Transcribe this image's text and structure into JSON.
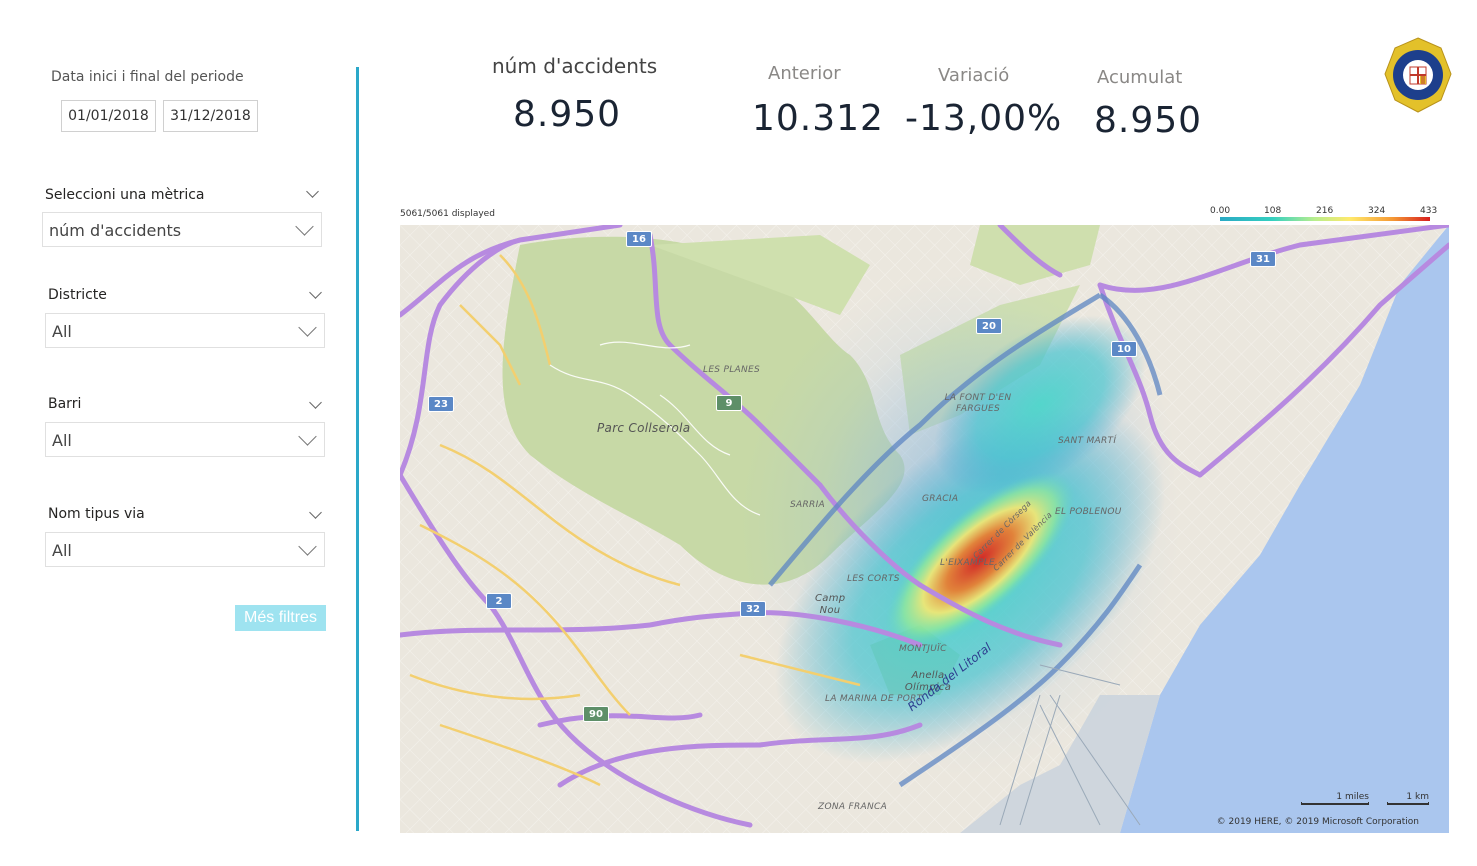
{
  "filters": {
    "date_title": "Data inici i final del periode",
    "date_start": "01/01/2018",
    "date_end": "31/12/2018",
    "metric": {
      "title": "Seleccioni una mètrica",
      "value": "núm d'accidents"
    },
    "district": {
      "title": "Districte",
      "value": "All"
    },
    "neighborhood": {
      "title": "Barri",
      "value": "All"
    },
    "street_type": {
      "title": "Nom tipus via",
      "value": "All"
    },
    "more_filters_label": "Més filtres"
  },
  "kpis": {
    "main_label": "núm d'accidents",
    "main_value": "8.950",
    "previous_label": "Anterior",
    "previous_value": "10.312",
    "variation_label": "Variació",
    "variation_value": "-13,00%",
    "cumulative_label": "Acumulat",
    "cumulative_value": "8.950"
  },
  "map": {
    "displayed_text": "5061/5061 displayed",
    "legend_ticks": [
      "0.00",
      "108",
      "216",
      "324",
      "433"
    ],
    "copyright": "© 2019 HERE, © 2019 Microsoft Corporation",
    "scale_miles": "1 miles",
    "scale_km": "1 km",
    "road_label": "Ronda del Litoral",
    "place_labels": {
      "park": "Parc Collserola",
      "les_planes": "LES PLANES",
      "font_en_fargues": "LA FONT D'EN FARGUES",
      "sant_marti": "SANT MARTÍ",
      "gracia": "GRACIA",
      "sarria": "SARRIA",
      "poblenou": "EL POBLENOU",
      "les_corts": "LES CORTS",
      "eixample": "L'EIXAMPLE",
      "camp_nou": "Camp Nou",
      "montjuic": "MONTJUÏC",
      "anella": "Anella Olímpica",
      "marina": "LA MARINA DE PORT",
      "zona_franca": "ZONA FRANCA",
      "carrer_corsega": "Carrer de Còrsega",
      "carrer_valencia": "Carrer de València"
    },
    "shields": {
      "s16": "16",
      "s31": "31",
      "s20": "20",
      "s10": "10",
      "s23": "23",
      "s9": "9",
      "s2": "2",
      "s32": "32",
      "s90": "90"
    }
  },
  "colors": {
    "accent_divider": "#2aa8c9",
    "button_bg": "#9ee3f0",
    "heat_high": "#d71e1e",
    "heat_low": "#2aa9c4"
  }
}
